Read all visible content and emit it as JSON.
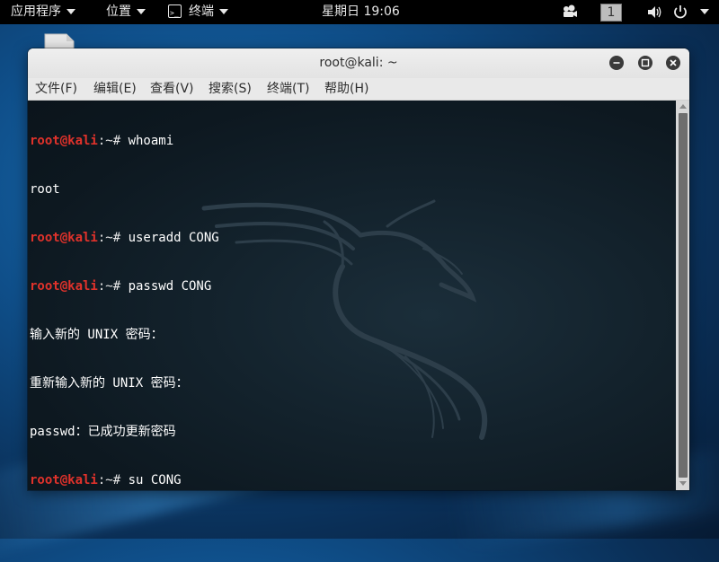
{
  "topbar": {
    "apps_label": "应用程序",
    "places_label": "位置",
    "terminal_label": "终端",
    "clock": "星期日 19:06",
    "workspace": "1"
  },
  "window": {
    "title": "root@kali: ~"
  },
  "menubar": {
    "items": [
      "文件(F)",
      "编辑(E)",
      "查看(V)",
      "搜索(S)",
      "终端(T)",
      "帮助(H)"
    ]
  },
  "terminal": {
    "prompt_user": "root@kali",
    "prompt_path": ":~",
    "prompt_sign": "# ",
    "lines": {
      "cmd1": "whoami",
      "out1": "root",
      "cmd2": "useradd CONG",
      "cmd3": "passwd CONG",
      "out2": "输入新的 UNIX 密码：",
      "out3": "重新输入新的 UNIX 密码：",
      "out4": "passwd：已成功更新密码",
      "cmd4": "su CONG",
      "shell": "$"
    }
  },
  "colors": {
    "prompt_user": "#e0322b",
    "prompt_path": "#8aa0ff",
    "terminal_bg": "#0d1820",
    "window_chrome": "#e9e9e9",
    "topbar": "#000000"
  },
  "icons": {
    "camera": "camera-icon",
    "volume": "volume-icon",
    "power": "power-icon",
    "terminal": "terminal-icon"
  }
}
